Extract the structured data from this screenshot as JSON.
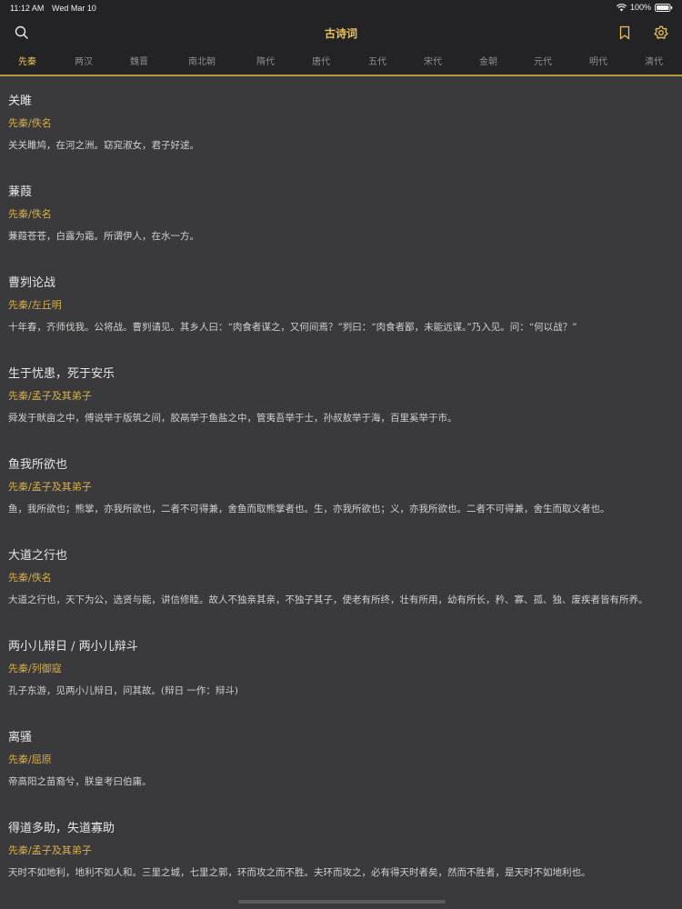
{
  "status": {
    "time": "11:12 AM",
    "date": "Wed Mar 10",
    "battery": "100%"
  },
  "nav": {
    "title": "古诗词"
  },
  "tabs": [
    {
      "label": "先秦",
      "active": true
    },
    {
      "label": "两汉",
      "active": false
    },
    {
      "label": "魏晋",
      "active": false
    },
    {
      "label": "南北朝",
      "active": false
    },
    {
      "label": "隋代",
      "active": false
    },
    {
      "label": "唐代",
      "active": false
    },
    {
      "label": "五代",
      "active": false
    },
    {
      "label": "宋代",
      "active": false
    },
    {
      "label": "金朝",
      "active": false
    },
    {
      "label": "元代",
      "active": false
    },
    {
      "label": "明代",
      "active": false
    },
    {
      "label": "清代",
      "active": false
    }
  ],
  "poems": [
    {
      "title": "关雎",
      "author": "先秦/佚名",
      "excerpt": "关关雎鸠，在河之洲。窈窕淑女，君子好逑。"
    },
    {
      "title": "蒹葭",
      "author": "先秦/佚名",
      "excerpt": "蒹葭苍苍，白露为霜。所谓伊人，在水一方。"
    },
    {
      "title": "曹刿论战",
      "author": "先秦/左丘明",
      "excerpt": "十年春，齐师伐我。公将战。曹刿请见。其乡人曰：“肉食者谋之，又何间焉？”刿曰：“肉食者鄙，未能远谋。”乃入见。问：“何以战？”"
    },
    {
      "title": "生于忧患，死于安乐",
      "author": "先秦/孟子及其弟子",
      "excerpt": "舜发于畎亩之中，傅说举于版筑之间，胶鬲举于鱼盐之中，管夷吾举于士，孙叔敖举于海，百里奚举于市。"
    },
    {
      "title": "鱼我所欲也",
      "author": "先秦/孟子及其弟子",
      "excerpt": "鱼，我所欲也；熊掌，亦我所欲也，二者不可得兼，舍鱼而取熊掌者也。生，亦我所欲也；义，亦我所欲也。二者不可得兼，舍生而取义者也。"
    },
    {
      "title": "大道之行也",
      "author": "先秦/佚名",
      "excerpt": "大道之行也，天下为公，选贤与能，讲信修睦。故人不独亲其亲，不独子其子，使老有所终，壮有所用，幼有所长，矜、寡、孤、独、废疾者皆有所养。"
    },
    {
      "title": "两小儿辩日 / 两小儿辩斗",
      "author": "先秦/列御寇",
      "excerpt": "孔子东游，见两小儿辩日，问其故。(辩日 一作：辩斗)"
    },
    {
      "title": "离骚",
      "author": "先秦/屈原",
      "excerpt": "帝高阳之苗裔兮，朕皇考曰伯庸。"
    },
    {
      "title": "得道多助，失道寡助",
      "author": "先秦/孟子及其弟子",
      "excerpt": "天时不如地利，地利不如人和。三里之城，七里之郭，环而攻之而不胜。夫环而攻之，必有得天时者矣，然而不胜者，是天时不如地利也。"
    }
  ],
  "colors": {
    "accent": "#e8c15a",
    "background": "#3a3a3c",
    "header": "#232325"
  }
}
